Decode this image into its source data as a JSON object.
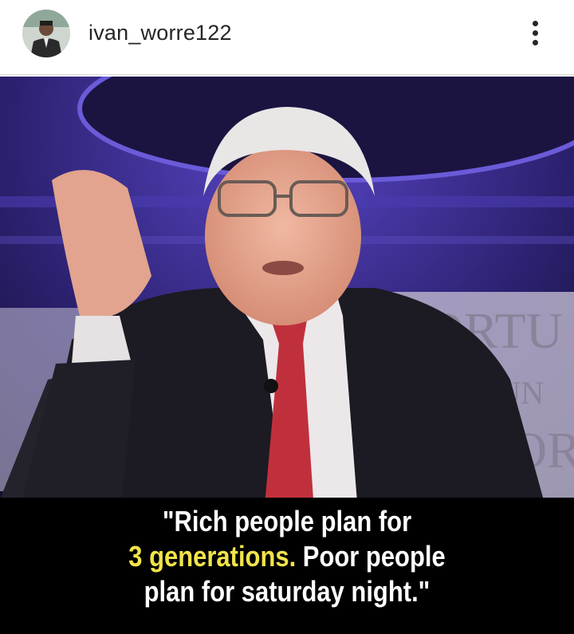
{
  "header": {
    "username": "ivan_worre122",
    "avatar_icon": "profile-avatar",
    "more_icon": "more-vertical-icon"
  },
  "post": {
    "image_description_icon": "speaker-photo",
    "background_text": "FORTUNE",
    "quote": {
      "line1": "\"Rich people plan for",
      "line2_highlight": "3 generations.",
      "line2_rest": " Poor people",
      "line3": "plan for saturday night.\""
    }
  },
  "colors": {
    "highlight": "#f2e44a",
    "caption_bg": "#000000",
    "stage": "#3d2f8c"
  }
}
